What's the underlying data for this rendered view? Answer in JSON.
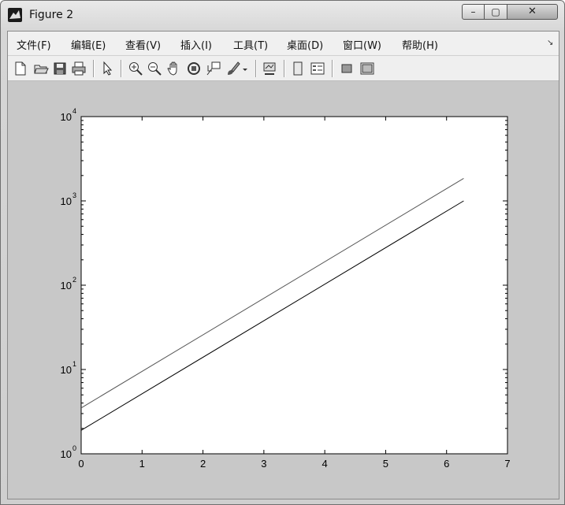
{
  "window": {
    "title": "Figure 2",
    "controls": {
      "minimize": "–",
      "maximize": "▢",
      "close": "✕"
    }
  },
  "menu": {
    "items": [
      "文件(F)",
      "编辑(E)",
      "查看(V)",
      "插入(I)",
      "工具(T)",
      "桌面(D)",
      "窗口(W)",
      "帮助(H)"
    ],
    "overflow_arrow": "↘"
  },
  "toolbar": {
    "icons": [
      "new-figure-icon",
      "open-file-icon",
      "save-icon",
      "print-icon",
      "pointer-arrow-icon",
      "zoom-in-icon",
      "zoom-out-icon",
      "pan-hand-icon",
      "rotate-3d-icon",
      "data-cursor-icon",
      "brush-icon",
      "brush-dropdown-icon",
      "link-plot-icon",
      "colorbar-icon",
      "legend-icon",
      "hide-plot-tools-icon",
      "show-plot-tools-icon"
    ]
  },
  "chart_data": {
    "type": "line",
    "y_scale": "log",
    "xlim": [
      0,
      7
    ],
    "ylim": [
      1,
      10000
    ],
    "x_ticks": [
      0,
      1,
      2,
      3,
      4,
      5,
      6,
      7
    ],
    "y_ticks": [
      {
        "base": "10",
        "exponent": "0",
        "value": 1
      },
      {
        "base": "10",
        "exponent": "1",
        "value": 10
      },
      {
        "base": "10",
        "exponent": "2",
        "value": 100
      },
      {
        "base": "10",
        "exponent": "3",
        "value": 1000
      },
      {
        "base": "10",
        "exponent": "4",
        "value": 10000
      }
    ],
    "grid": false,
    "series": [
      {
        "color": "#555555",
        "x": [
          0,
          6.28
        ],
        "y": [
          3.5,
          1850
        ]
      },
      {
        "color": "#000000",
        "x": [
          0,
          6.28
        ],
        "y": [
          1.9,
          1000
        ]
      }
    ]
  }
}
